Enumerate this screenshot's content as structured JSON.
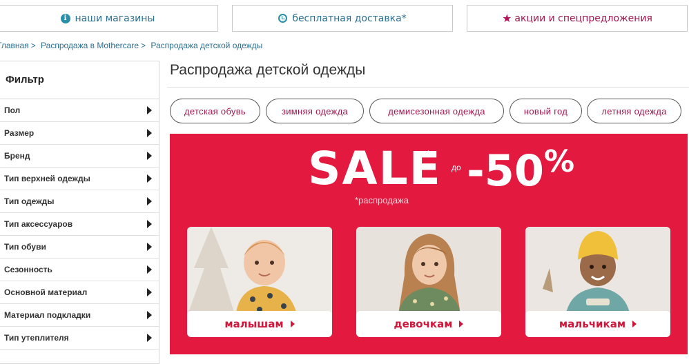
{
  "topbar": {
    "stores": {
      "icon": "info-icon",
      "label": "наши магазины"
    },
    "delivery": {
      "icon": "clock-icon",
      "label": "бесплатная доставка*"
    },
    "promo": {
      "icon": "star-icon",
      "label": "акции и спецпредложения"
    }
  },
  "breadcrumb": {
    "items": [
      "Главная",
      "Распродажа в Mothercare",
      "Распродажа детской одежды"
    ]
  },
  "sidebar": {
    "title": "Фильтр",
    "items": [
      {
        "label": "Пол"
      },
      {
        "label": "Размер"
      },
      {
        "label": "Бренд"
      },
      {
        "label": "Тип верхней одежды"
      },
      {
        "label": "Тип одежды"
      },
      {
        "label": "Тип аксессуаров"
      },
      {
        "label": "Тип обуви"
      },
      {
        "label": "Сезонность"
      },
      {
        "label": "Основной материал"
      },
      {
        "label": "Материал подкладки"
      },
      {
        "label": "Тип утеплителя"
      }
    ]
  },
  "main": {
    "title": "Распродажа детской одежды",
    "pills": [
      "детская обувь",
      "зимняя одежда",
      "демисезонная одежда",
      "новый год",
      "летняя одежда"
    ]
  },
  "banner": {
    "headline": "SALE",
    "asterisk": "*",
    "upto": "до",
    "discount": "-50",
    "percent": "%",
    "note": "*распродажа",
    "cards": [
      {
        "label": "малышам"
      },
      {
        "label": "девочкам"
      },
      {
        "label": "мальчикам"
      }
    ]
  },
  "colors": {
    "accent": "#a0154d",
    "link": "#2a6f91",
    "banner": "#e3193f"
  }
}
